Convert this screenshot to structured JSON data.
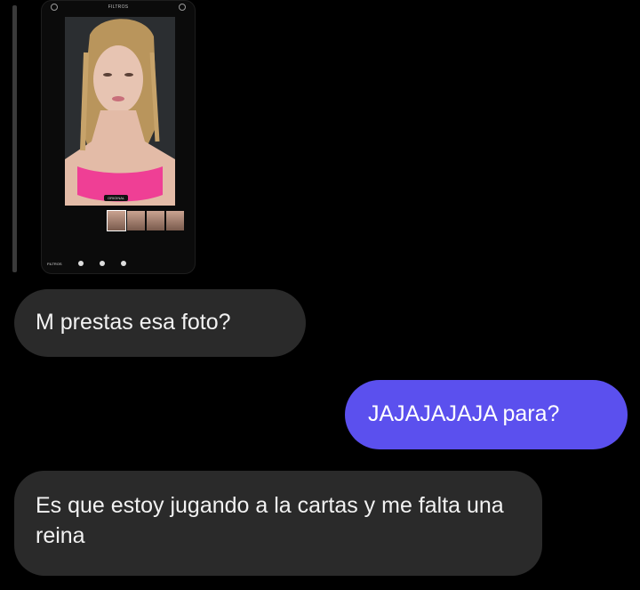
{
  "shared_image": {
    "alt_title": "FILTROS",
    "original_label": "ORIGINAL",
    "tool_label": "FILTROS"
  },
  "messages": [
    {
      "direction": "incoming",
      "text": "M prestas esa foto?"
    },
    {
      "direction": "outgoing",
      "text": "JAJAJAJAJA para?"
    },
    {
      "direction": "incoming",
      "text": "Es que estoy jugando a la cartas y me falta una reina"
    }
  ],
  "colors": {
    "background": "#000000",
    "incoming_bubble": "#2a2a2a",
    "outgoing_bubble": "#5b50ee"
  }
}
